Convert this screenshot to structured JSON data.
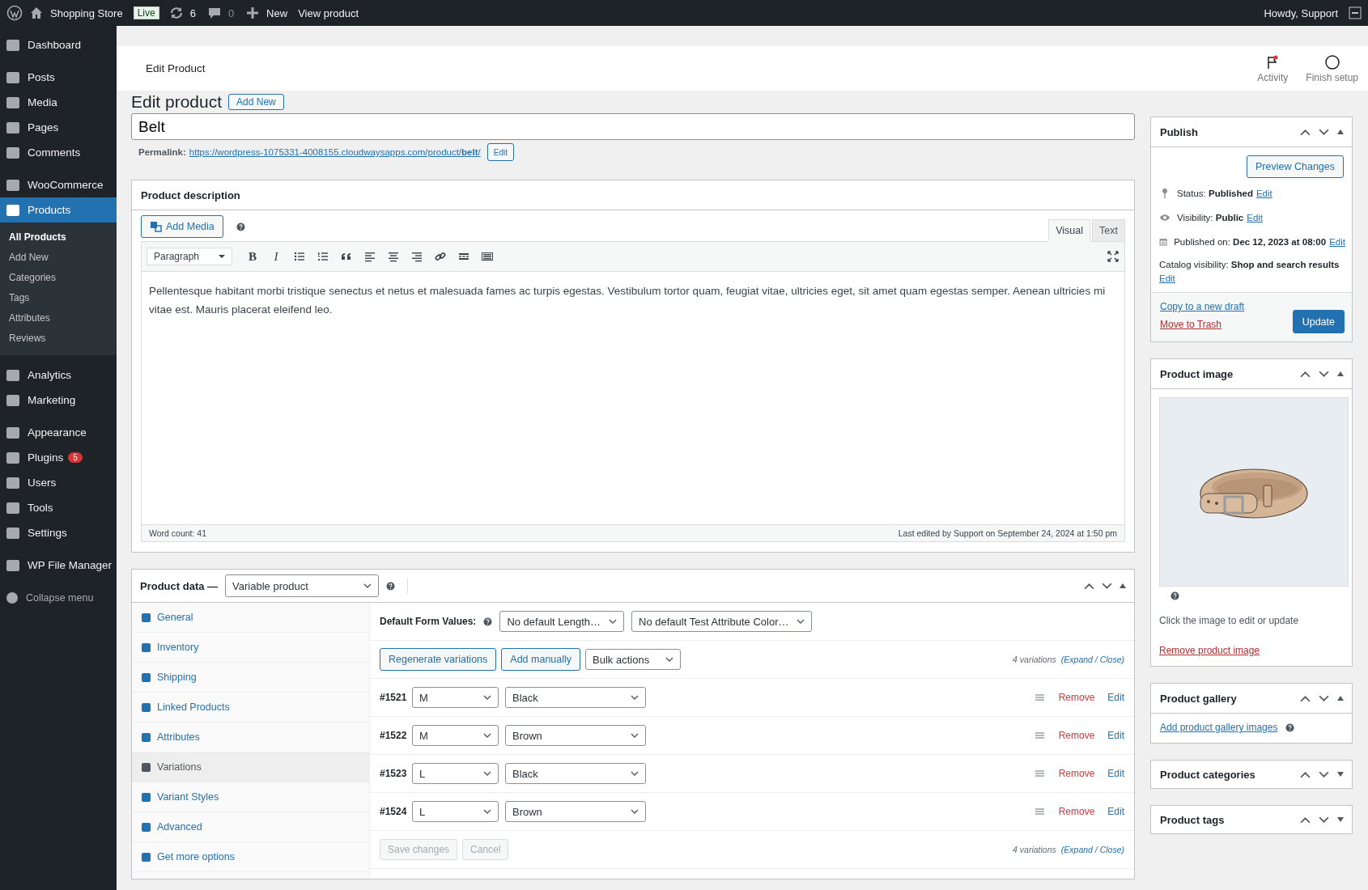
{
  "admin_bar": {
    "site": "Shopping Store",
    "badge": "Live",
    "updates": "6",
    "comments": "0",
    "new": "New",
    "view": "View product",
    "greeting": "Howdy, Support"
  },
  "sidebar": {
    "sections": [
      {
        "items": [
          {
            "label": "Dashboard",
            "selected": false
          }
        ]
      },
      {
        "items": [
          {
            "label": "Posts",
            "selected": false
          },
          {
            "label": "Media",
            "selected": false
          },
          {
            "label": "Pages",
            "selected": false
          },
          {
            "label": "Comments",
            "selected": false
          }
        ]
      },
      {
        "items": [
          {
            "label": "WooCommerce",
            "selected": false
          },
          {
            "label": "Products",
            "selected": true,
            "children": [
              {
                "label": "All Products",
                "selected": true
              },
              {
                "label": "Add New",
                "selected": false
              },
              {
                "label": "Categories",
                "selected": false
              },
              {
                "label": "Tags",
                "selected": false
              },
              {
                "label": "Attributes",
                "selected": false
              },
              {
                "label": "Reviews",
                "selected": false
              }
            ]
          }
        ]
      },
      {
        "items": [
          {
            "label": "Analytics",
            "selected": false
          },
          {
            "label": "Marketing",
            "selected": false
          }
        ]
      },
      {
        "items": [
          {
            "label": "Appearance",
            "selected": false
          },
          {
            "label": "Plugins",
            "selected": false,
            "badge": "5"
          },
          {
            "label": "Users",
            "selected": false
          },
          {
            "label": "Tools",
            "selected": false
          },
          {
            "label": "Settings",
            "selected": false
          }
        ]
      },
      {
        "items": [
          {
            "label": "WP File Manager",
            "selected": false
          }
        ]
      }
    ],
    "collapse": "Collapse menu"
  },
  "header": {
    "title": "Edit Product",
    "actions": [
      {
        "label": "Activity"
      },
      {
        "label": "Finish setup"
      }
    ]
  },
  "heading": {
    "title": "Edit product",
    "add_new": "Add New"
  },
  "title_field": {
    "value": "Belt"
  },
  "permalink": {
    "label": "Permalink:",
    "url": "https://wordpress-1075331-4008155.cloudwaysapps.com/product/**belt**/",
    "edit": "Edit"
  },
  "description": {
    "title": "Product description",
    "add_media": "Add Media",
    "tabs": [
      {
        "label": "Visual",
        "selected": true
      },
      {
        "label": "Text",
        "selected": false
      }
    ],
    "format": "Paragraph",
    "format_buttons": [
      "B",
      "I"
    ],
    "text": "Pellentesque habitant morbi tristique senectus et netus et malesuada fames ac turpis egestas. Vestibulum tortor quam, feugiat vitae, ultricies eget,  sit amet quam egestas semper. Aenean ultricies mi vitae est. Mauris placerat eleifend leo.",
    "word_count": "Word count: 41",
    "last_edited": "Last edited by Support on September 24, 2024 at 1:50 pm"
  },
  "product_data": {
    "title": "Product data —",
    "type": "Variable product",
    "tabs": [
      {
        "label": "General",
        "selected": false
      },
      {
        "label": "Inventory",
        "selected": false
      },
      {
        "label": "Shipping",
        "selected": false
      },
      {
        "label": "Linked Products",
        "selected": false
      },
      {
        "label": "Attributes",
        "selected": false
      },
      {
        "label": "Variations",
        "selected": true
      },
      {
        "label": "Variant Styles",
        "selected": false
      },
      {
        "label": "Advanced",
        "selected": false
      },
      {
        "label": "Get more options",
        "selected": false
      }
    ],
    "default_label": "Default Form Values:",
    "defaults": [
      "No default Length…",
      "No default Test Attribute Color…"
    ],
    "regenerate": "Regenerate variations",
    "add_manually": "Add manually",
    "bulk": "Bulk actions",
    "summaries": [
      {
        "count": "4 variations",
        "expand_close": "(Expand / Close)"
      },
      {
        "count": "4 variations",
        "expand_close": "(Expand / Close)"
      }
    ],
    "variations": [
      {
        "id": "#1521",
        "length": "M",
        "option": "Black",
        "remove": "Remove",
        "edit": "Edit"
      },
      {
        "id": "#1522",
        "length": "M",
        "option": "Brown",
        "remove": "Remove",
        "edit": "Edit"
      },
      {
        "id": "#1523",
        "length": "L",
        "option": "Black",
        "remove": "Remove",
        "edit": "Edit"
      },
      {
        "id": "#1524",
        "length": "L",
        "option": "Brown",
        "remove": "Remove",
        "edit": "Edit"
      }
    ],
    "save": {
      "label": "Save changes",
      "disabled": true
    },
    "cancel": {
      "label": "Cancel",
      "disabled": true
    }
  },
  "publish": {
    "title": "Publish",
    "preview": "Preview Changes",
    "rows": [
      {
        "text": "Status: **Published**",
        "link": "Edit"
      },
      {
        "text": "Visibility: **Public**",
        "link": "Edit"
      },
      {
        "text": "Published on: **Dec 12, 2023 at 08:00**",
        "link": "Edit"
      },
      {
        "text": "Catalog visibility: **Shop and search results**",
        "link": "Edit"
      }
    ],
    "copy": "Copy to a new draft",
    "trash": "Move to Trash",
    "update": "Update"
  },
  "product_image": {
    "title": "Product image",
    "hint": "Click the image to edit or update",
    "remove": "Remove product image"
  },
  "gallery": {
    "title": "Product gallery",
    "link": "Add product gallery images"
  },
  "categories": {
    "title": "Product categories"
  },
  "tags": {
    "title": "Product tags"
  }
}
